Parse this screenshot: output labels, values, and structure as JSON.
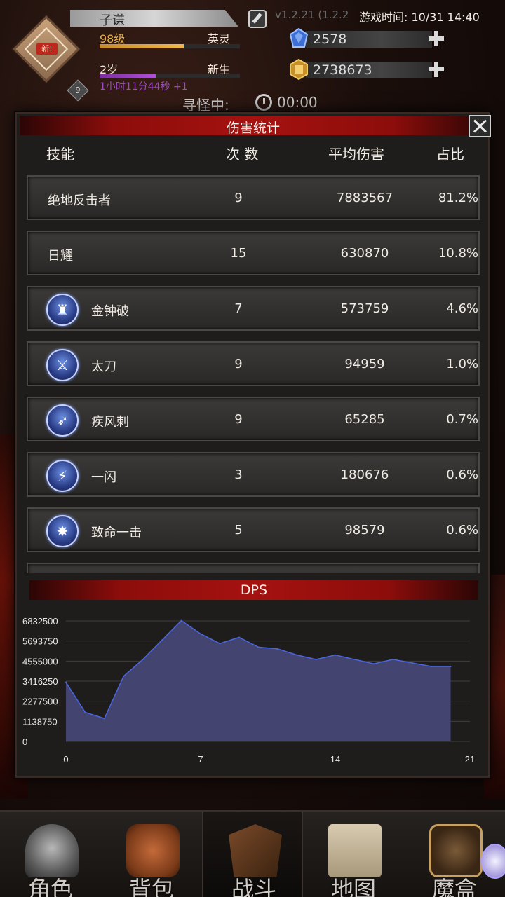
{
  "header": {
    "player_name": "子谦",
    "version": "v1.2.21 (1.2.2",
    "game_time": "游戏时间: 10/31 14:40",
    "new_badge": "新!",
    "avatar_level": "9",
    "level": "98级",
    "rank": "英灵",
    "level_progress": 0.6,
    "age": "2岁",
    "stage": "新生",
    "age_progress": 0.4,
    "timer": "1小时11分44秒 +1",
    "diamonds": "2578",
    "gold": "2738673",
    "search_label": "寻怪中:",
    "search_time": "00:00"
  },
  "modal": {
    "title": "伤害统计",
    "columns": {
      "skill": "技能",
      "count": "次 数",
      "avg": "平均伤害",
      "pct": "占比"
    },
    "rows": [
      {
        "name": "绝地反击者",
        "count": "9",
        "avg": "7883567",
        "pct": "81.2%",
        "icon": ""
      },
      {
        "name": "日耀",
        "count": "15",
        "avg": "630870",
        "pct": "10.8%",
        "icon": ""
      },
      {
        "name": "金钟破",
        "count": "7",
        "avg": "573759",
        "pct": "4.6%",
        "icon": "shield-knight-icon"
      },
      {
        "name": "太刀",
        "count": "9",
        "avg": "94959",
        "pct": "1.0%",
        "icon": "sword-icon"
      },
      {
        "name": "疾风刺",
        "count": "9",
        "avg": "65285",
        "pct": "0.7%",
        "icon": "triple-arrow-icon"
      },
      {
        "name": "一闪",
        "count": "3",
        "avg": "180676",
        "pct": "0.6%",
        "icon": "slash-icon"
      },
      {
        "name": "致命一击",
        "count": "5",
        "avg": "98579",
        "pct": "0.6%",
        "icon": "burst-icon"
      }
    ],
    "chart_header": "DPS"
  },
  "chart_data": {
    "type": "area",
    "title": "DPS",
    "x": [
      0,
      1,
      2,
      3,
      4,
      5,
      6,
      7,
      8,
      9,
      10,
      11,
      12,
      13,
      14,
      15,
      16,
      17,
      18,
      19,
      20
    ],
    "values": [
      3350000,
      1650000,
      1300000,
      3700000,
      4650000,
      5750000,
      6850000,
      6100000,
      5550000,
      5900000,
      5350000,
      5250000,
      4900000,
      4650000,
      4900000,
      4650000,
      4400000,
      4650000,
      4450000,
      4250000,
      4250000
    ],
    "xticks": [
      "0",
      "7",
      "14",
      "21"
    ],
    "yticks": [
      "0",
      "1138750",
      "2277500",
      "3416250",
      "4555000",
      "5693750",
      "6832500"
    ],
    "xlim": [
      0,
      21
    ],
    "ylim": [
      0,
      6832500
    ],
    "grid": true,
    "fill_color": "#444470",
    "line_color": "#4a66e0"
  },
  "nav": [
    {
      "label": "角色",
      "icon": "helmet-icon"
    },
    {
      "label": "背包",
      "icon": "backpack-icon"
    },
    {
      "label": "战斗",
      "icon": "sword-shield-icon"
    },
    {
      "label": "地图",
      "icon": "scroll-map-icon"
    },
    {
      "label": "魔盒",
      "icon": "magic-box-icon"
    }
  ]
}
